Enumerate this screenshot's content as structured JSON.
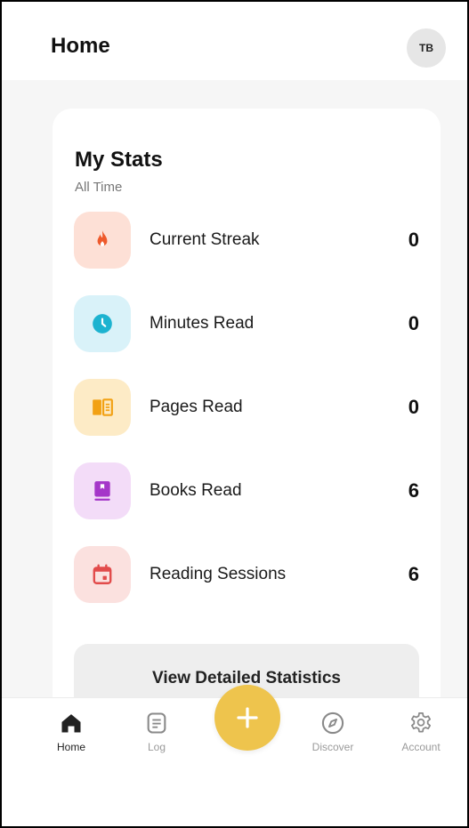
{
  "header": {
    "title": "Home",
    "avatar_initials": "TB"
  },
  "stats_card": {
    "title": "My Stats",
    "subtitle": "All Time",
    "items": [
      {
        "label": "Current Streak",
        "value": "0",
        "icon": "flame-icon",
        "icon_color": "#ee5a2c",
        "bg_color": "#fde0d6"
      },
      {
        "label": "Minutes Read",
        "value": "0",
        "icon": "clock-icon",
        "icon_color": "#1db3d0",
        "bg_color": "#d9f2f9"
      },
      {
        "label": "Pages Read",
        "value": "0",
        "icon": "book-open-icon",
        "icon_color": "#f2a114",
        "bg_color": "#fdebc6"
      },
      {
        "label": "Books Read",
        "value": "6",
        "icon": "book-icon",
        "icon_color": "#a536c9",
        "bg_color": "#f3dcf8"
      },
      {
        "label": "Reading Sessions",
        "value": "6",
        "icon": "calendar-icon",
        "icon_color": "#e24b4b",
        "bg_color": "#fbe1df"
      }
    ],
    "details_button_label": "View Detailed Statistics"
  },
  "bottom_nav": {
    "items": [
      {
        "label": "Home",
        "icon": "home-icon",
        "active": true
      },
      {
        "label": "Log",
        "icon": "log-icon",
        "active": false
      },
      {
        "label": "Discover",
        "icon": "compass-icon",
        "active": false
      },
      {
        "label": "Account",
        "icon": "gear-icon",
        "active": false
      }
    ],
    "fab_icon": "plus-icon",
    "fab_color": "#eec44d"
  }
}
